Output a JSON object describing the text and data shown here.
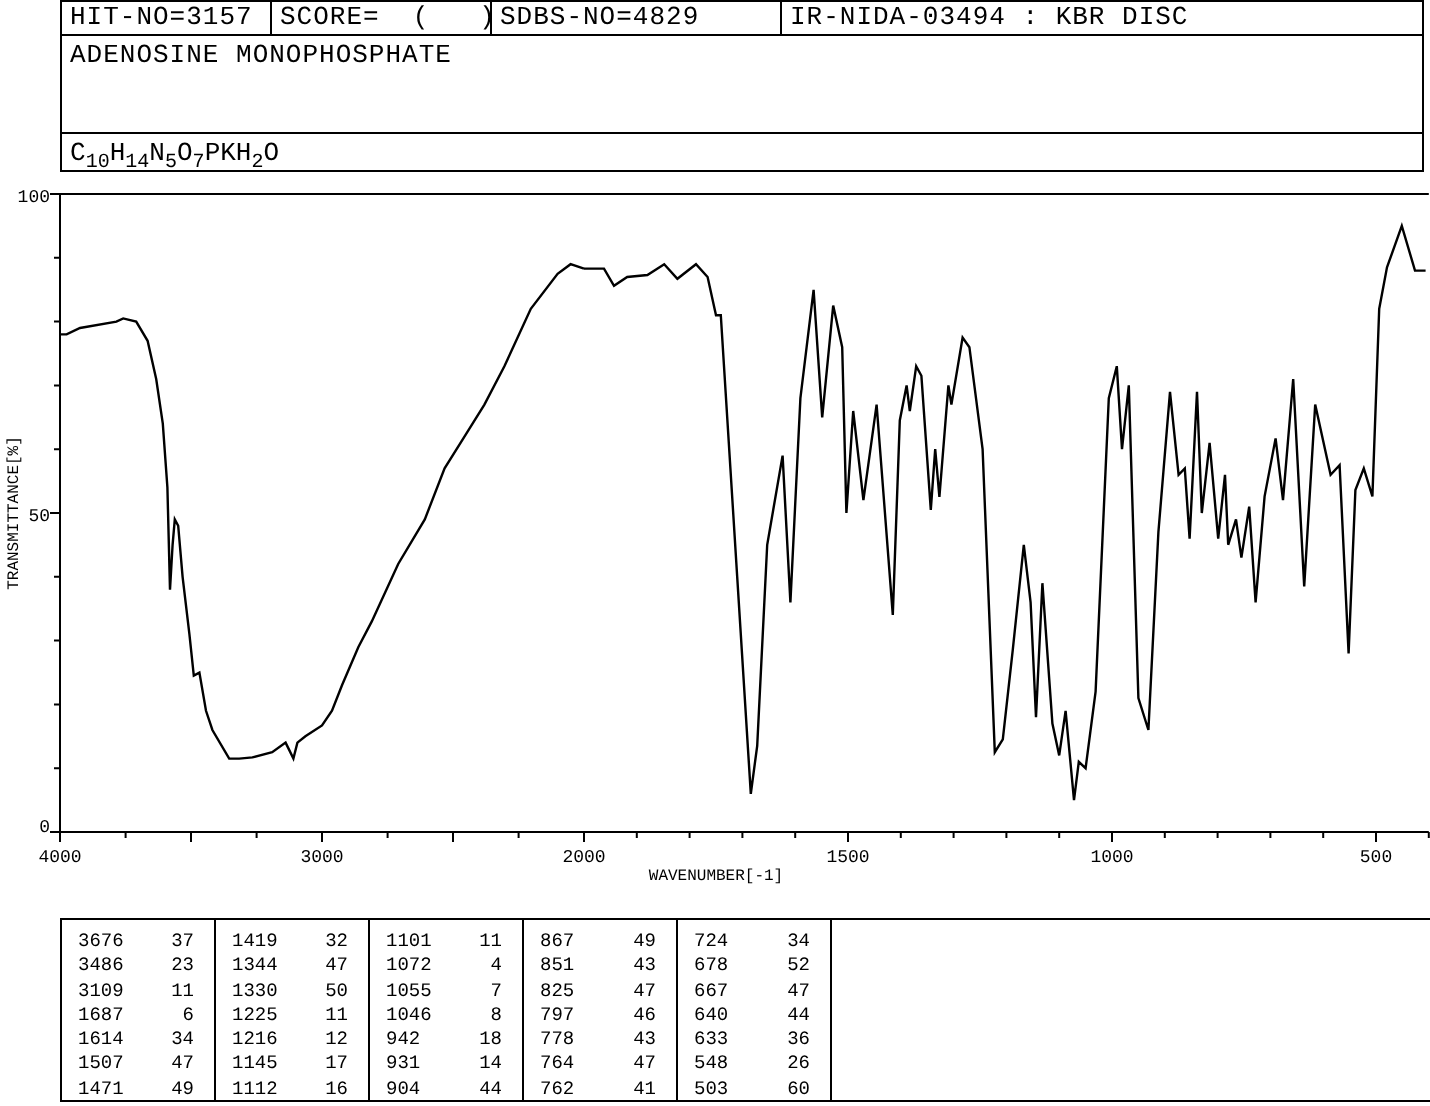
{
  "header": {
    "hit_no": "HIT-NO=3157",
    "score": "SCORE=  (   )",
    "sdbs_no": "SDBS-NO=4829",
    "method": "IR-NIDA-03494 : KBR DISC",
    "compound": "ADENOSINE MONOPHOSPHATE",
    "formula": "C$_{10}$H$_{14}$N$_{5}$O$_{7}$PKH$_{2}$O"
  },
  "spectrum": [
    {
      "chart_data": {
        "type": "line",
        "ylabel": "TRANSMITTANCE[%]",
        "xlim": [
          4000,
          2000
        ],
        "ylim": [
          0,
          100
        ],
        "xticks": [
          4000,
          3000
        ],
        "yticks": [
          0,
          50,
          100
        ],
        "x": [
          4000,
          3975,
          3924,
          3785,
          3759,
          3709,
          3666,
          3633,
          3608,
          3590,
          3580,
          3570,
          3562,
          3549,
          3532,
          3506,
          3489,
          3468,
          3443,
          3418,
          3354,
          3316,
          3266,
          3190,
          3139,
          3109,
          3094,
          3063,
          3000,
          2962,
          2924,
          2861,
          2810,
          2709,
          2608,
          2532,
          2456,
          2380,
          2304,
          2203,
          2101,
          2051,
          2000
        ],
        "series": [
          {
            "values": [
              78,
              78,
              79,
              80,
              80.5,
              80,
              77,
              71,
              64,
              54,
              38,
              45,
              49,
              48,
              40,
              31,
              24.5,
              25,
              19,
              16,
              11.5,
              11.5,
              11.7,
              12.5,
              14,
              11.5,
              14,
              15,
              16.7,
              19,
              23,
              29,
              33,
              42,
              49,
              57,
              62,
              67,
              73,
              82,
              87.5,
              89,
              88.3
            ]
          }
        ]
      }
    },
    {
      "chart_data": {
        "type": "line",
        "xlabel": "WAVENUMBER[-1]",
        "xlim": [
          2000,
          400
        ],
        "ylim": [
          0,
          100
        ],
        "xticks": [
          2000,
          1500,
          1000,
          500
        ],
        "x": [
          2000,
          1962,
          1943,
          1918,
          1880,
          1848,
          1823,
          1788,
          1766,
          1750,
          1741,
          1710,
          1684,
          1672,
          1653,
          1624,
          1609,
          1590,
          1565,
          1549,
          1528,
          1511,
          1503,
          1490,
          1471,
          1446,
          1415,
          1402,
          1389,
          1383,
          1371,
          1361,
          1343,
          1335,
          1327,
          1310,
          1304,
          1283,
          1270,
          1245,
          1222,
          1207,
          1188,
          1167,
          1154,
          1144,
          1132,
          1113,
          1100,
          1088,
          1072,
          1063,
          1050,
          1031,
          1006,
          991,
          981,
          968,
          950,
          931,
          912,
          890,
          874,
          862,
          853,
          839,
          830,
          815,
          799,
          786,
          780,
          765,
          755,
          740,
          728,
          711,
          690,
          676,
          657,
          636,
          615,
          586,
          569,
          552,
          539,
          523,
          507,
          494,
          479,
          451,
          426,
          406
        ],
        "series": [
          {
            "values": [
              88.3,
              88.3,
              85.6,
              87,
              87.3,
              89,
              86.7,
              89,
              87,
              81,
              81,
              40,
              6,
              13.5,
              45,
              59,
              36,
              68,
              85,
              65,
              82.5,
              76,
              50,
              66,
              52,
              67,
              34,
              64.5,
              70,
              66,
              73,
              71.5,
              50.5,
              60,
              52.5,
              70,
              67,
              77.5,
              76,
              60,
              12.5,
              14.5,
              28.6,
              45,
              36,
              18,
              39,
              17,
              12,
              19,
              5,
              11,
              10,
              22,
              68,
              73,
              60,
              70,
              21,
              16,
              47,
              69,
              56,
              57,
              46,
              69,
              50,
              61,
              46,
              56,
              45,
              49,
              43,
              51,
              36,
              52.6,
              61.7,
              52,
              71,
              38.5,
              67,
              56,
              57.5,
              28,
              53.6,
              57,
              52.6,
              82,
              88.5,
              95,
              88,
              88
            ]
          }
        ]
      }
    }
  ],
  "peaks": [
    [
      [
        "3676",
        "37"
      ],
      [
        "3486",
        "23"
      ],
      [
        "3109",
        "11"
      ],
      [
        "1687",
        "6"
      ],
      [
        "1614",
        "34"
      ],
      [
        "1507",
        "47"
      ],
      [
        "1471",
        "49"
      ]
    ],
    [
      [
        "1419",
        "32"
      ],
      [
        "1344",
        "47"
      ],
      [
        "1330",
        "50"
      ],
      [
        "1225",
        "11"
      ],
      [
        "1216",
        "12"
      ],
      [
        "1145",
        "17"
      ],
      [
        "1112",
        "16"
      ]
    ],
    [
      [
        "1101",
        "11"
      ],
      [
        "1072",
        "4"
      ],
      [
        "1055",
        "7"
      ],
      [
        "1046",
        "8"
      ],
      [
        "942",
        "18"
      ],
      [
        "931",
        "14"
      ],
      [
        "904",
        "44"
      ]
    ],
    [
      [
        "867",
        "49"
      ],
      [
        "851",
        "43"
      ],
      [
        "825",
        "47"
      ],
      [
        "797",
        "46"
      ],
      [
        "778",
        "43"
      ],
      [
        "764",
        "47"
      ],
      [
        "762",
        "41"
      ]
    ],
    [
      [
        "724",
        "34"
      ],
      [
        "678",
        "52"
      ],
      [
        "667",
        "47"
      ],
      [
        "640",
        "44"
      ],
      [
        "633",
        "36"
      ],
      [
        "548",
        "26"
      ],
      [
        "503",
        "60"
      ]
    ]
  ]
}
